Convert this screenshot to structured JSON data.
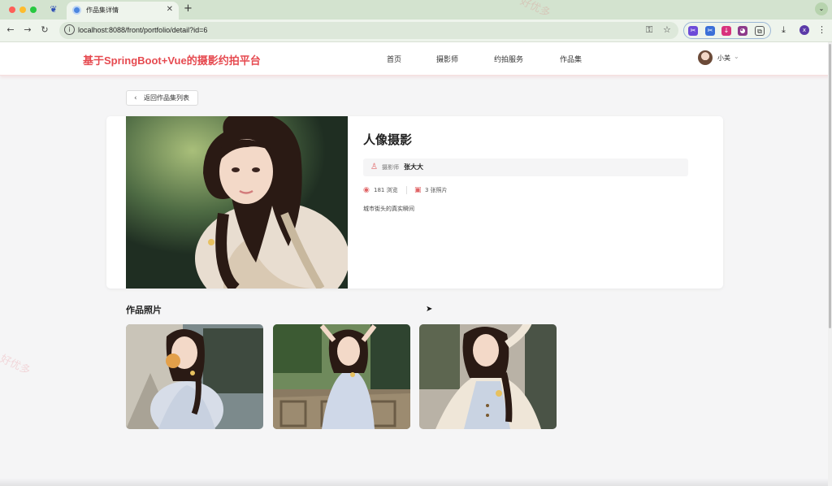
{
  "browser": {
    "tab_title": "作品集详情",
    "tab_close_glyph": "✕",
    "new_tab_glyph": "+",
    "url": "localhost:8088/front/portfolio/detail?id=6",
    "profile_initial": "x",
    "icons": [
      "back-arrow-icon",
      "forward-arrow-icon",
      "reload-icon",
      "site-info-icon",
      "key-icon",
      "star-icon",
      "extension-icon",
      "download-icon"
    ]
  },
  "site": {
    "brand": "基于SpringBoot+Vue的摄影约拍平台",
    "nav": [
      {
        "label": "首页"
      },
      {
        "label": "摄影师"
      },
      {
        "label": "约拍服务"
      },
      {
        "label": "作品集"
      }
    ],
    "user_name": "小美",
    "accent_color": "#e64a50"
  },
  "page": {
    "back_label": "返回作品集列表",
    "portfolio": {
      "title": "人像摄影",
      "photographer_label": "摄影师",
      "photographer_name": "张大大",
      "views_text": "181 浏览",
      "photos_text": "3 张照片",
      "description": "城市街头的真实瞬间"
    },
    "photos_section_title": "作品照片",
    "photos": [
      {
        "name": "photo-1"
      },
      {
        "name": "photo-2"
      },
      {
        "name": "photo-3"
      }
    ]
  },
  "watermark_text": "好优多"
}
